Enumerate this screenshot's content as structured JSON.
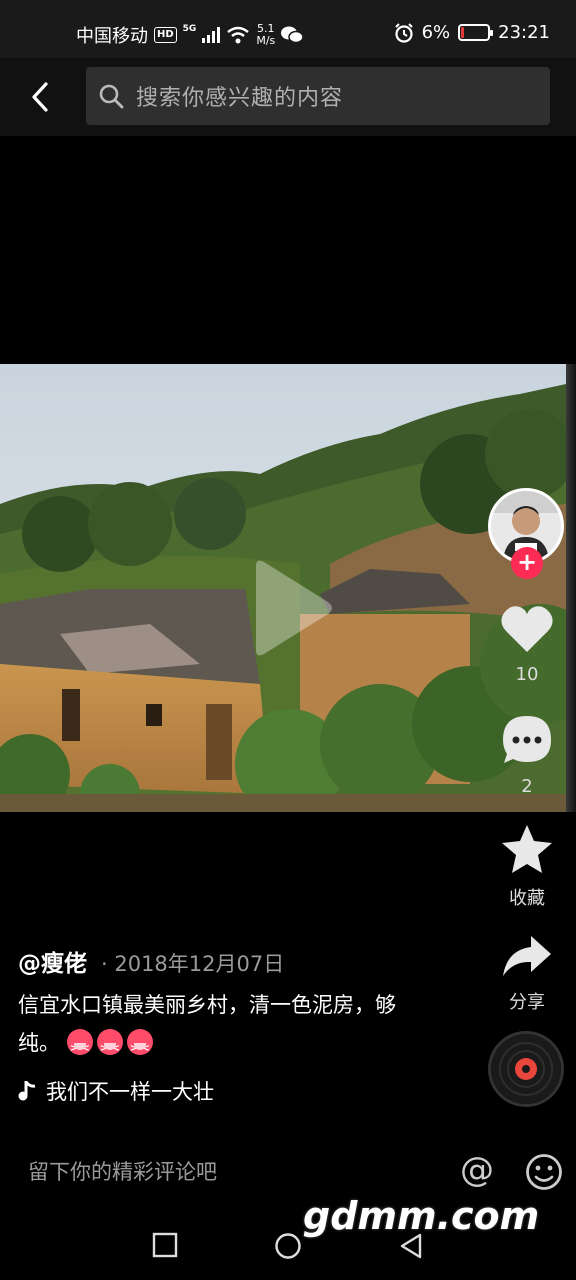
{
  "status_bar": {
    "carrier": "中国移动",
    "hd": "HD",
    "network": "5G",
    "speed_value": "5.1",
    "speed_unit": "M/s",
    "battery_pct": "6%",
    "battery_level": 0.06,
    "time": "23:21"
  },
  "search": {
    "placeholder": "搜索你感兴趣的内容"
  },
  "video": {
    "author": "@瘦佬",
    "date": "· 2018年12月07日",
    "caption": "信宜水口镇最美丽乡村，清一色泥房，够纯。",
    "music": "我们不一样一大壮"
  },
  "actions": {
    "likes": "10",
    "comments": "2",
    "favorite_label": "收藏",
    "share_label": "分享"
  },
  "comment": {
    "placeholder": "留下你的精彩评论吧",
    "at_symbol": "@"
  },
  "watermark": "gdmm.com",
  "icons": [
    "back-icon",
    "search-icon",
    "play-icon",
    "plus-icon",
    "heart-icon",
    "comment-icon",
    "star-icon",
    "share-icon",
    "music-note-icon",
    "emoji-icon",
    "square-icon",
    "circle-icon",
    "triangle-icon"
  ]
}
